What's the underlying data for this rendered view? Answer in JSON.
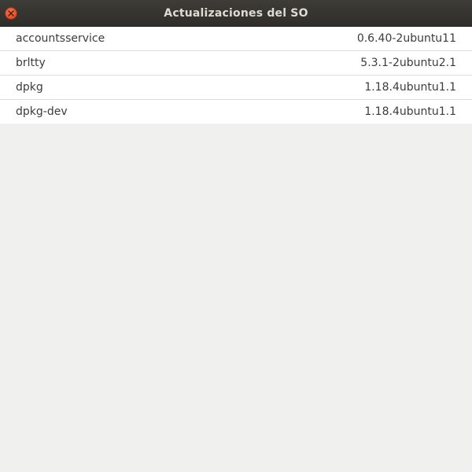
{
  "window": {
    "title": "Actualizaciones del SO"
  },
  "icons": {
    "close": "close-icon"
  },
  "colors": {
    "titlebar": "#2f2e2a",
    "close_button": "#e05a2b",
    "list_background": "#ffffff",
    "window_background": "#f0f1ef"
  },
  "packages": [
    {
      "name": "accountsservice",
      "version": "0.6.40-2ubuntu11"
    },
    {
      "name": "brltty",
      "version": "5.3.1-2ubuntu2.1"
    },
    {
      "name": "dpkg",
      "version": "1.18.4ubuntu1.1"
    },
    {
      "name": "dpkg-dev",
      "version": "1.18.4ubuntu1.1"
    }
  ]
}
